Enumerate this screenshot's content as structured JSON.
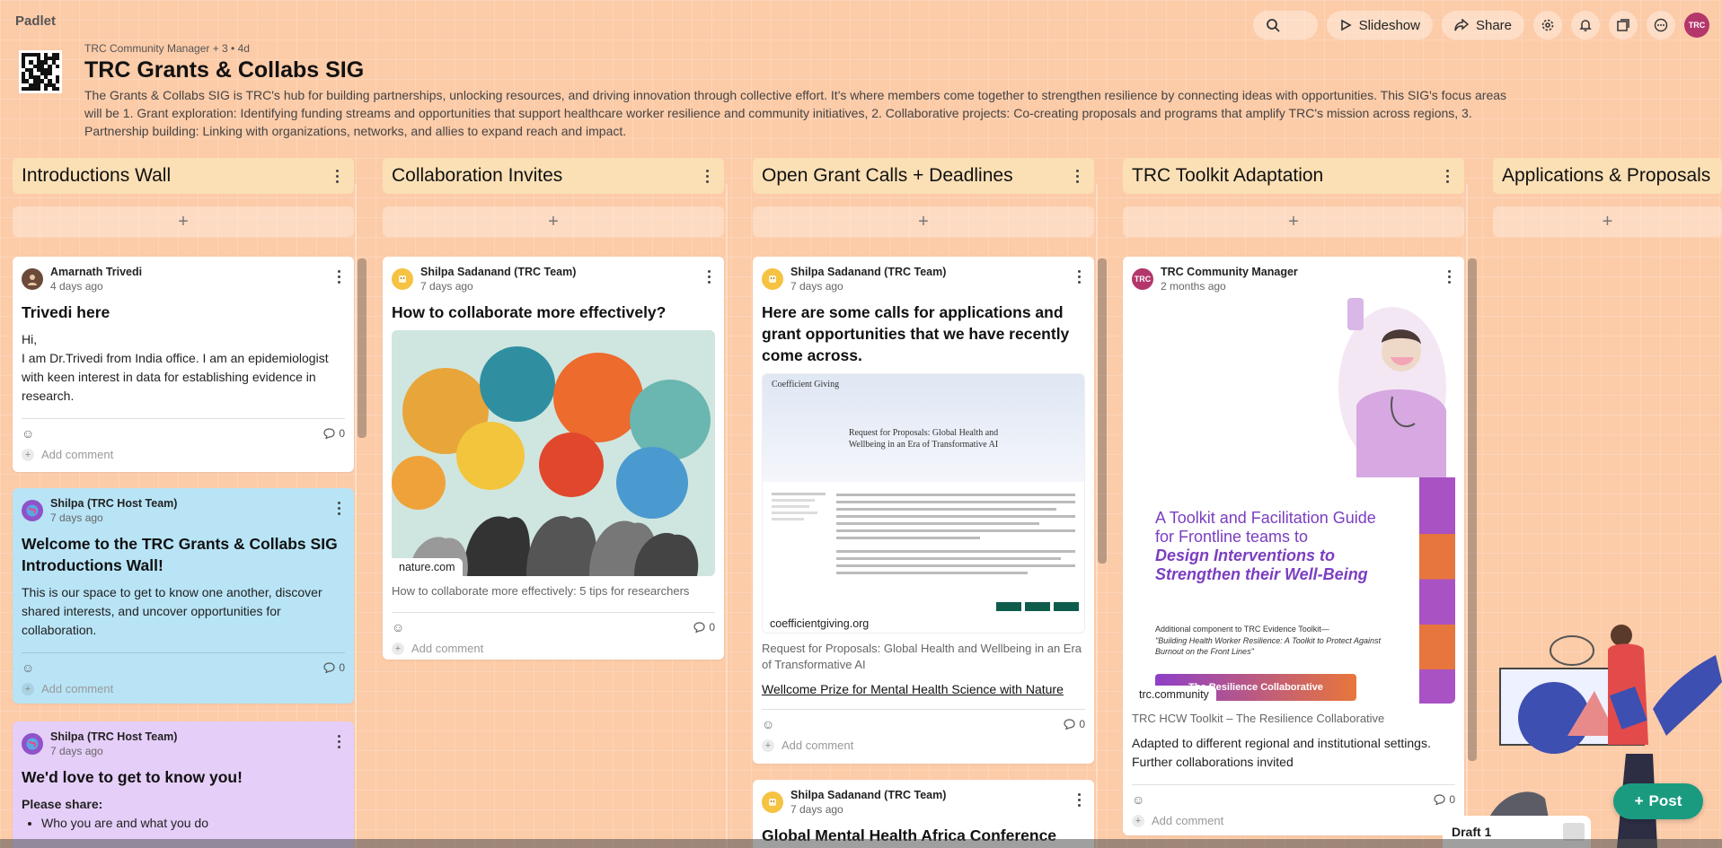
{
  "app": {
    "logo": "Padlet"
  },
  "toolbar": {
    "slideshow_label": "Slideshow",
    "share_label": "Share",
    "avatar_initials": "TRC"
  },
  "board": {
    "meta": "TRC Community Manager + 3 • 4d",
    "title": "TRC Grants & Collabs SIG",
    "description": "The Grants & Collabs SIG is TRC's hub for building partnerships, unlocking resources, and driving innovation through collective effort. It's where members come together to strengthen resilience by connecting ideas with opportunities. This SIG's focus areas will be 1. Grant exploration: Identifying funding streams and opportunities that support healthcare worker resilience and community initiatives, 2. Collaborative projects: Co-creating proposals and programs that amplify TRC's mission across regions, 3. Partnership building: Linking with organizations, networks, and allies to expand reach and impact."
  },
  "columns": [
    {
      "title": "Introductions Wall"
    },
    {
      "title": "Collaboration Invites"
    },
    {
      "title": "Open Grant Calls + Deadlines"
    },
    {
      "title": "TRC Toolkit Adaptation"
    },
    {
      "title": "Applications & Proposals"
    }
  ],
  "add_symbol": "+",
  "add_comment_label": "Add comment",
  "posts": {
    "intro1": {
      "author": "Amarnath Trivedi",
      "time": "4 days ago",
      "title": "Trivedi here",
      "body_1": "Hi,",
      "body_2": "I am Dr.Trivedi from India office. I am an epidemiologist with keen interest in data for establishing evidence in research.",
      "comments": "0"
    },
    "intro2": {
      "author": "Shilpa (TRC Host Team)",
      "time": "7 days ago",
      "title": "Welcome to the TRC Grants & Collabs SIG Introductions Wall!",
      "body": "This is our space to get to know one another, discover shared interests, and uncover opportunities for collaboration.",
      "comments": "0"
    },
    "intro3": {
      "author": "Shilpa (TRC Host Team)",
      "time": "7 days ago",
      "title": "We'd love to get to know you!",
      "body_heading": "Please share:",
      "bullet_1": "Who you are and what you do"
    },
    "collab1": {
      "author": "Shilpa Sadanand (TRC Team)",
      "time": "7 days ago",
      "title": "How to collaborate more effectively?",
      "link_domain": "nature.com",
      "link_caption": "How to collaborate more effectively: 5 tips for researchers",
      "comments": "0"
    },
    "grant1": {
      "author": "Shilpa Sadanand (TRC Team)",
      "time": "7 days ago",
      "title": "Here are some calls for applications and grant opportunities that we have recently come across.",
      "preview_site": "Coefficient Giving",
      "preview_heading": "Request for Proposals: Global Health and Wellbeing in an Era of Transformative AI",
      "link_domain": "coefficientgiving.org",
      "link_caption": "Request for Proposals: Global Health and Wellbeing in an Era of Transformative AI",
      "link_2": "Wellcome Prize for Mental Health Science with Nature",
      "comments": "0"
    },
    "grant2": {
      "author": "Shilpa Sadanand (TRC Team)",
      "time": "7 days ago",
      "title": "Global Mental Health Africa Conference"
    },
    "toolkit1": {
      "author": "TRC Community Manager",
      "time": "2 months ago",
      "cover_line_1": "A Toolkit and Facilitation Guide for Frontline teams to",
      "cover_line_2": "Design Interventions to Strengthen their Well-Being",
      "cover_sub": "Additional component to TRC Evidence Toolkit—",
      "cover_sub_2": "\"Building Health Worker Resilience: A Toolkit to Protect Against Burnout on the Front Lines\"",
      "cover_banner": "The Resilience Collaborative",
      "link_domain": "trc.community",
      "link_caption": "TRC HCW Toolkit – The Resilience Collaborative",
      "body": "Adapted to different regional and institutional settings. Further collaborations invited",
      "comments": "0"
    }
  },
  "post_button_label": "Post",
  "draft_label": "Draft 1",
  "colors": {
    "background": "#fccba8",
    "column_header": "#fbe0b6",
    "accent_green": "#1a9b80",
    "brand_magenta": "#b3376b",
    "card_blue": "#b8e4f6",
    "card_purple": "#e5cef8"
  }
}
